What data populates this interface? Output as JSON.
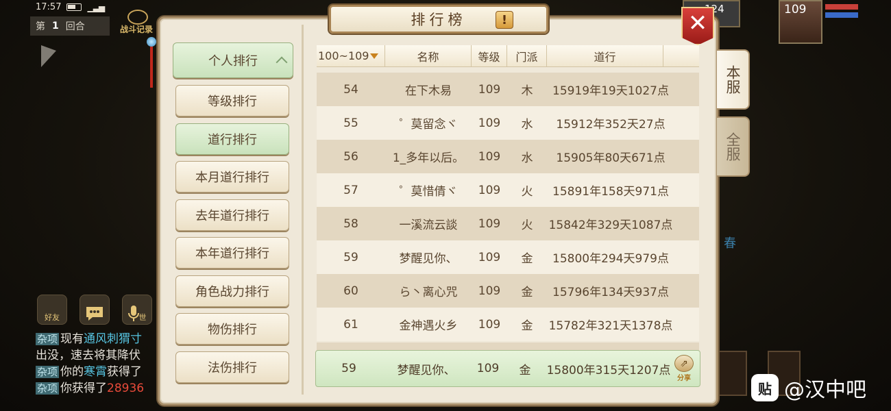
{
  "status": {
    "time": "17:57"
  },
  "hud": {
    "round_prefix": "第",
    "round_number": "1",
    "round_suffix": "回合",
    "battle_record": "战斗记录",
    "friends_label": "好友",
    "world_label": "世",
    "spring_text": "春",
    "player_level": "109",
    "other_level": "124"
  },
  "chat": [
    {
      "tag": "杂项",
      "parts": [
        {
          "t": "现有"
        },
        {
          "t": "通风刺猬寸",
          "c": "hl1"
        }
      ]
    },
    {
      "tag": "",
      "parts": [
        {
          "t": "出没，速去将其降伏"
        }
      ]
    },
    {
      "tag": "杂项",
      "parts": [
        {
          "t": "你的"
        },
        {
          "t": "寒霄",
          "c": "hl1"
        },
        {
          "t": "获得了"
        }
      ]
    },
    {
      "tag": "杂项",
      "parts": [
        {
          "t": "你获得了"
        },
        {
          "t": "28936",
          "c": "hl2"
        }
      ]
    }
  ],
  "panel": {
    "title": "排行榜",
    "info_icon": "!",
    "close_icon": "✕"
  },
  "menu": {
    "header": "个人排行",
    "items": [
      "等级排行",
      "道行排行",
      "本月道行排行",
      "去年道行排行",
      "本年道行排行",
      "角色战力排行",
      "物伤排行",
      "法伤排行"
    ],
    "selected_index": 1
  },
  "table": {
    "range_filter": "100~109",
    "columns": [
      "名称",
      "等级",
      "门派",
      "道行"
    ],
    "rows": [
      {
        "rank": "54",
        "name": "在下木易",
        "level": "109",
        "school": "木",
        "dao": "15919年19天1027点"
      },
      {
        "rank": "55",
        "name": "゜莫留念ヾ",
        "level": "109",
        "school": "水",
        "dao": "15912年352天27点"
      },
      {
        "rank": "56",
        "name": "1_多年以后。",
        "level": "109",
        "school": "水",
        "dao": "15905年80天671点"
      },
      {
        "rank": "57",
        "name": "゜莫惜倩ヾ",
        "level": "109",
        "school": "火",
        "dao": "15891年158天971点"
      },
      {
        "rank": "58",
        "name": "一溪流云談",
        "level": "109",
        "school": "火",
        "dao": "15842年329天1087点"
      },
      {
        "rank": "59",
        "name": "梦醒见你、",
        "level": "109",
        "school": "金",
        "dao": "15800年294天979点"
      },
      {
        "rank": "60",
        "name": "ら丶离心咒",
        "level": "109",
        "school": "金",
        "dao": "15796年134天937点"
      },
      {
        "rank": "61",
        "name": "金神遇火乡",
        "level": "109",
        "school": "金",
        "dao": "15782年321天1378点"
      }
    ]
  },
  "self_row": {
    "rank": "59",
    "name": "梦醒见你、",
    "level": "109",
    "school": "金",
    "dao": "15800年315天1207点",
    "share_label": "分享"
  },
  "side_tabs": {
    "server": "本服",
    "all": "全服"
  },
  "watermark": {
    "logo": "贴",
    "text": "@汉中吧"
  }
}
